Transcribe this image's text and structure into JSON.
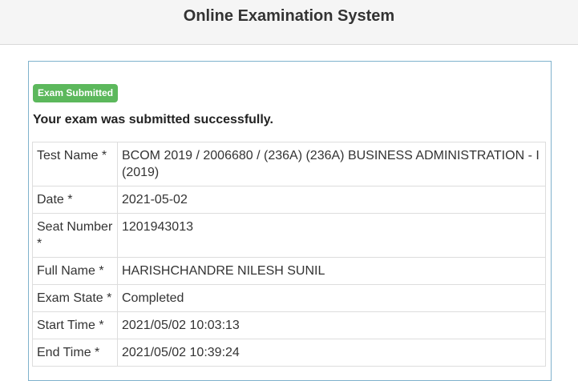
{
  "header": {
    "title": "Online Examination System"
  },
  "status": {
    "badge": "Exam Submitted",
    "message": "Your exam was submitted successfully.",
    "badge_color": "#5cb85c"
  },
  "details": [
    {
      "label": "Test Name *",
      "value": "BCOM 2019 / 2006680 / (236A) (236A) BUSINESS ADMINISTRATION - I (2019)"
    },
    {
      "label": "Date *",
      "value": "2021-05-02"
    },
    {
      "label": "Seat Number *",
      "value": "1201943013"
    },
    {
      "label": "Full Name *",
      "value": "HARISHCHANDRE NILESH SUNIL"
    },
    {
      "label": "Exam State *",
      "value": "Completed"
    },
    {
      "label": "Start Time *",
      "value": "2021/05/02 10:03:13"
    },
    {
      "label": "End Time *",
      "value": "2021/05/02 10:39:24"
    }
  ]
}
